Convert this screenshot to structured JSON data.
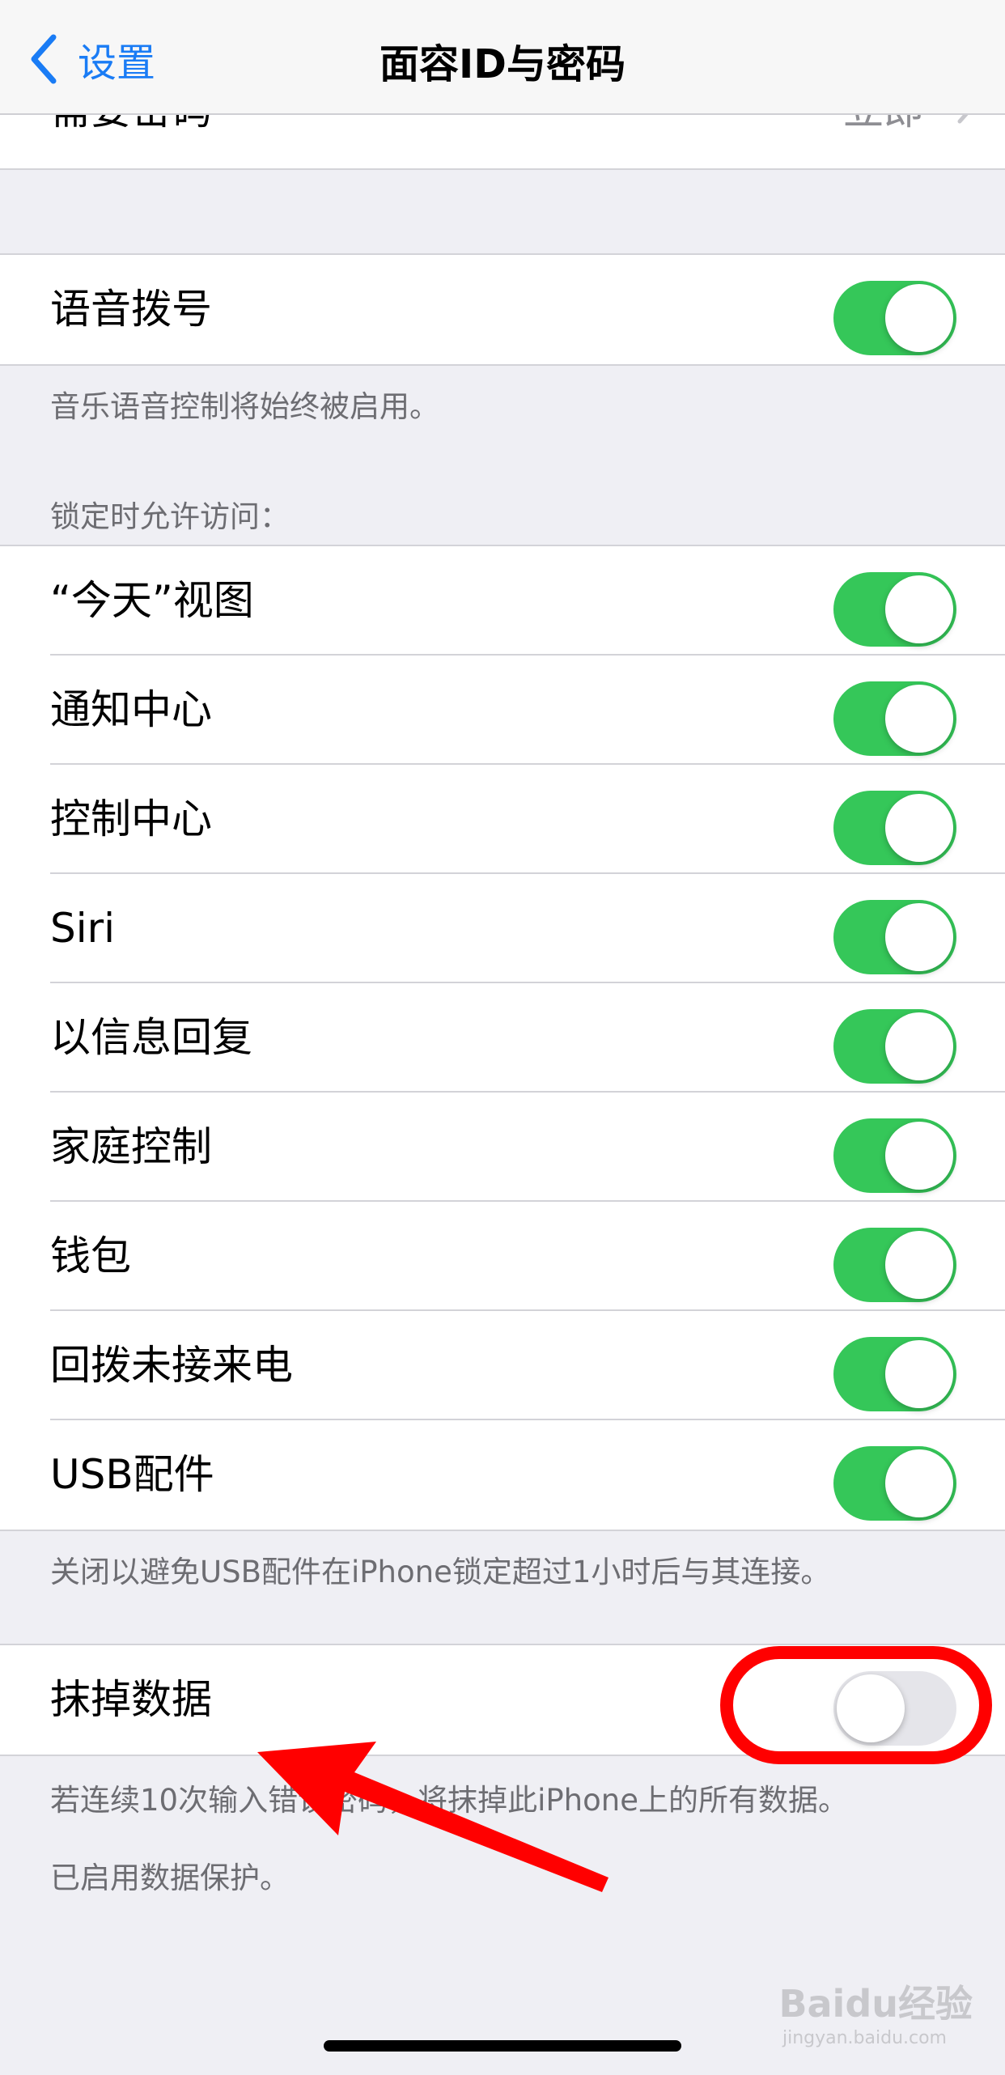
{
  "nav": {
    "back_label": "设置",
    "title": "面容ID与密码"
  },
  "partial_row": {
    "label": "需要密码",
    "value": "立即"
  },
  "voice_dial": {
    "label": "语音拨号",
    "on": true,
    "footer": "音乐语音控制将始终被启用。"
  },
  "locked_access": {
    "header": "锁定时允许访问：",
    "items": [
      {
        "label": "“今天”视图",
        "on": true
      },
      {
        "label": "通知中心",
        "on": true
      },
      {
        "label": "控制中心",
        "on": true
      },
      {
        "label": "Siri",
        "on": true
      },
      {
        "label": "以信息回复",
        "on": true
      },
      {
        "label": "家庭控制",
        "on": true
      },
      {
        "label": "钱包",
        "on": true
      },
      {
        "label": "回拨未接来电",
        "on": true
      },
      {
        "label": "USB配件",
        "on": true
      }
    ],
    "footer": "关闭以避免USB配件在iPhone锁定超过1小时后与其连接。"
  },
  "erase_data": {
    "label": "抹掉数据",
    "on": false,
    "footer_1": "若连续10次输入错误密码，将抹掉此iPhone上的所有数据。",
    "footer_2": "已启用数据保护。"
  },
  "watermark": {
    "text": "Baidu经验",
    "sub": "jingyan.baidu.com"
  },
  "colors": {
    "switch_on": "#35c759",
    "switch_off": "#e5e5ea",
    "link_blue": "#1a7cf5",
    "annotation_red": "#ff0000"
  }
}
